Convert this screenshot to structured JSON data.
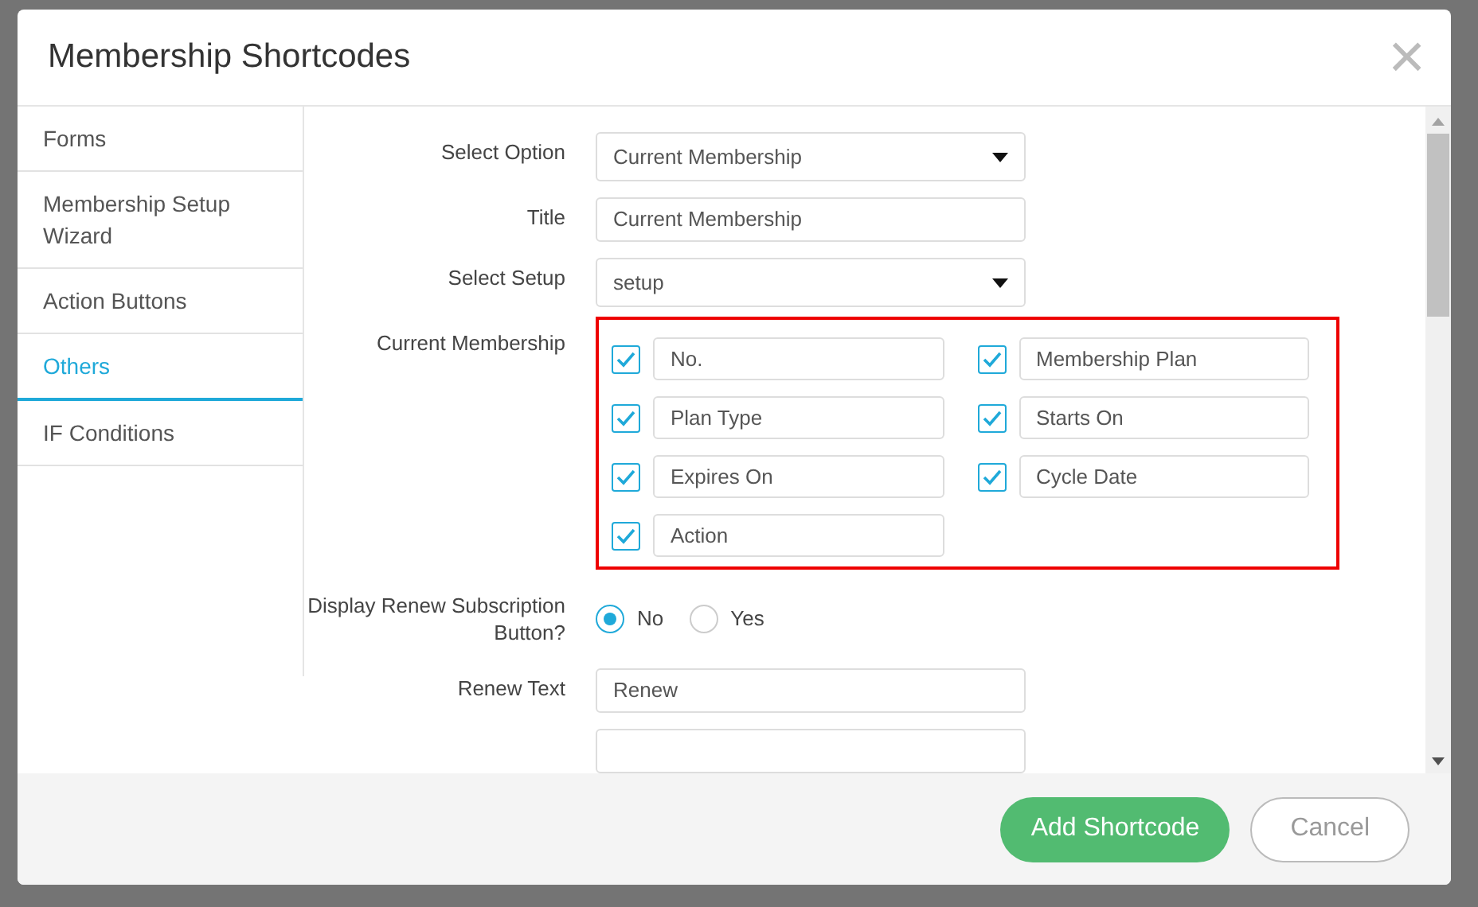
{
  "dialog": {
    "title": "Membership Shortcodes",
    "close": "×"
  },
  "sidebar": {
    "items": [
      {
        "label": "Forms",
        "selected": false
      },
      {
        "label": "Membership Setup Wizard",
        "selected": false
      },
      {
        "label": "Action Buttons",
        "selected": false
      },
      {
        "label": "Others",
        "selected": true
      },
      {
        "label": "IF Conditions",
        "selected": false
      }
    ]
  },
  "form": {
    "rows": [
      {
        "kind": "select",
        "label": "Select Option",
        "value": "Current Membership"
      },
      {
        "kind": "text",
        "label": "Title",
        "value": "Current Membership"
      },
      {
        "kind": "select",
        "label": "Select Setup",
        "value": "setup"
      },
      {
        "kind": "columns",
        "label": "Current Membership",
        "items": [
          {
            "value": "No.",
            "checked": true
          },
          {
            "value": "Membership Plan",
            "checked": true
          },
          {
            "value": "Plan Type",
            "checked": true
          },
          {
            "value": "Starts On",
            "checked": true
          },
          {
            "value": "Expires On",
            "checked": true
          },
          {
            "value": "Cycle Date",
            "checked": true
          },
          {
            "value": "Action",
            "checked": true
          }
        ]
      },
      {
        "kind": "radio",
        "label": "Display Renew Subscription Button?",
        "options": [
          {
            "label": "No",
            "selected": true
          },
          {
            "label": "Yes",
            "selected": false
          }
        ]
      },
      {
        "kind": "text",
        "label": "Renew Text",
        "value": "Renew"
      },
      {
        "kind": "text",
        "label": "",
        "value": ""
      }
    ]
  },
  "footer": {
    "buttons": [
      {
        "label": "Add Shortcode",
        "kind": "primary"
      },
      {
        "label": "Cancel",
        "kind": "secondary"
      }
    ]
  }
}
